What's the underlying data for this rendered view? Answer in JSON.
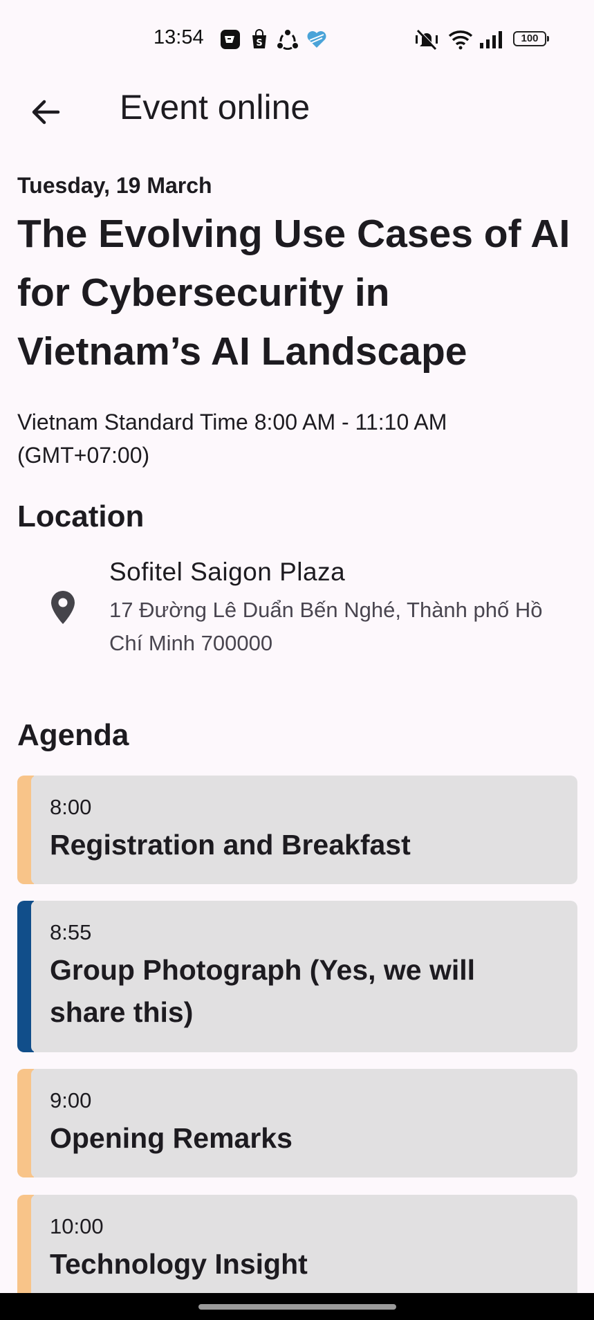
{
  "status_bar": {
    "time": "13:54",
    "battery": "100",
    "left_icons": [
      "app-notification-icon",
      "shop-icon",
      "sync-icon",
      "heart-icon"
    ],
    "right_icons": [
      "mute-icon",
      "wifi-icon",
      "signal-icon",
      "battery-icon"
    ]
  },
  "app_bar": {
    "title": "Event online",
    "back_icon": "arrow-left-icon"
  },
  "event": {
    "date": "Tuesday, 19 March",
    "title": "The Evolving Use Cases of AI for Cybersecurity in Vietnam’s AI Landscape",
    "time_range": "Vietnam Standard Time 8:00 AM - 11:10 AM (GMT+07:00)"
  },
  "location": {
    "heading": "Location",
    "icon": "location-pin-icon",
    "name": "Sofitel Saigon Plaza",
    "address": "17 Đường Lê Duẩn Bến Nghé, Thành phố Hồ Chí Minh 700000"
  },
  "agenda": {
    "heading": "Agenda",
    "items": [
      {
        "time": "8:00",
        "title": "Registration and Breakfast",
        "accent": "#f8c489"
      },
      {
        "time": "8:55",
        "title": "Group Photograph (Yes, we will share this)",
        "accent": "#114e8a"
      },
      {
        "time": "9:00",
        "title": "Opening Remarks",
        "accent": "#f8c489"
      },
      {
        "time": "10:00",
        "title": "Technology Insight",
        "accent": "#f8c489"
      }
    ]
  },
  "colors": {
    "background": "#fdf8fc",
    "card": "#e1e0e1",
    "accent_orange": "#f8c489",
    "accent_blue": "#114e8a"
  }
}
